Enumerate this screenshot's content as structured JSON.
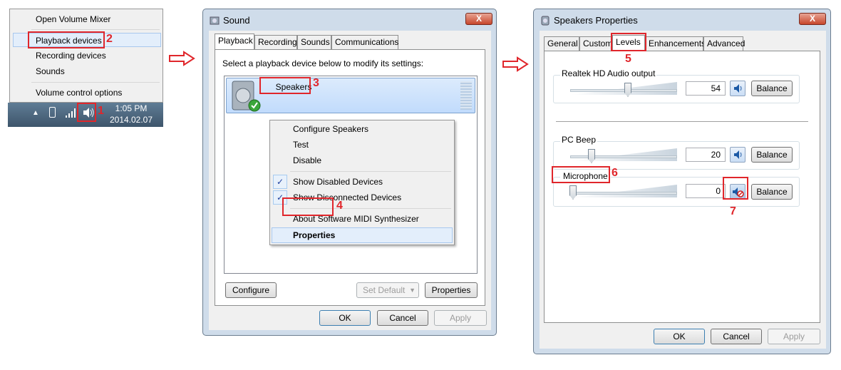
{
  "tray_menu": {
    "items": [
      "Open Volume Mixer",
      "Playback devices",
      "Recording devices",
      "Sounds",
      "Volume control options"
    ]
  },
  "taskbar": {
    "time": "1:05 PM",
    "date": "2014.02.07"
  },
  "steps": [
    "1",
    "2",
    "3",
    "4",
    "5",
    "6",
    "7"
  ],
  "sound_dialog": {
    "title": "Sound",
    "close": "X",
    "tabs": [
      "Playback",
      "Recording",
      "Sounds",
      "Communications"
    ],
    "instruction": "Select a playback device below to modify its settings:",
    "device_name": "Speakers",
    "context_menu": [
      "Configure Speakers",
      "Test",
      "Disable",
      "Show Disabled Devices",
      "Show Disconnected Devices",
      "About Software MIDI Synthesizer",
      "Properties"
    ],
    "configure": "Configure",
    "set_default": "Set Default",
    "properties": "Properties",
    "ok": "OK",
    "cancel": "Cancel",
    "apply": "Apply"
  },
  "speakers_dialog": {
    "title": "Speakers Properties",
    "close": "X",
    "tabs": [
      "General",
      "Custom",
      "Levels",
      "Enhancements",
      "Advanced"
    ],
    "levels": [
      {
        "label": "Realtek HD Audio output",
        "value": "54",
        "balance": "Balance",
        "fraction": 0.54,
        "muted": false
      },
      {
        "label": "PC Beep",
        "value": "20",
        "balance": "Balance",
        "fraction": 0.2,
        "muted": false
      },
      {
        "label": "Microphone",
        "value": "0",
        "balance": "Balance",
        "fraction": 0.0,
        "muted": true
      }
    ],
    "ok": "OK",
    "cancel": "Cancel",
    "apply": "Apply"
  },
  "colors": {
    "annotation": "#e0262b",
    "window_frame": "#cfdcea",
    "selection": "#c1dbfc"
  }
}
